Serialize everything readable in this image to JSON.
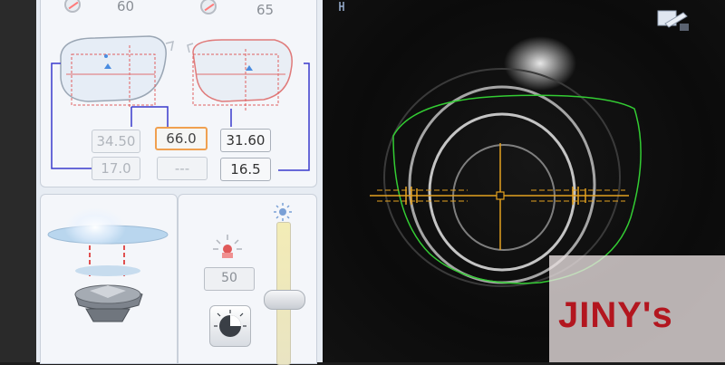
{
  "top_values": {
    "left": "60",
    "right": "65"
  },
  "measurements": {
    "row1": {
      "left": "34.50",
      "center": "66.0",
      "right": "31.60"
    },
    "row2": {
      "left": "17.0",
      "center": "---",
      "right": "16.5"
    }
  },
  "brightness": {
    "value": "50",
    "slider_level_percent": 45
  },
  "watermark": "JINY's",
  "colors": {
    "selected_border": "#f0a050",
    "frame_outline": "#3a3acc",
    "green_trace": "#33cc33",
    "crosshair": "#e3a120",
    "watermark_red": "#b3161f"
  },
  "icons": {
    "eye": "eye-slash-icon",
    "lamp": "lamp-icon",
    "sun": "sun-icon",
    "dial": "dial-icon",
    "edit": "edit-icon"
  }
}
